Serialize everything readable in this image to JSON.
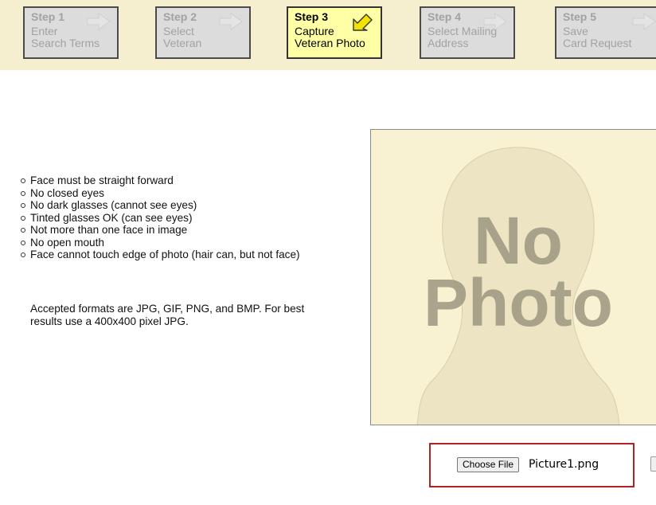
{
  "wizard": {
    "steps": [
      {
        "num": "Step 1",
        "line1": "Enter",
        "line2": "Search Terms",
        "state": "inactive",
        "icon": "arrow-right-icon"
      },
      {
        "num": "Step 2",
        "line1": "Select",
        "line2": "Veteran",
        "state": "inactive",
        "icon": "arrow-right-icon"
      },
      {
        "num": "Step 3",
        "line1": "Capture",
        "line2": "Veteran Photo",
        "state": "active",
        "icon": "arrow-down-left-icon"
      },
      {
        "num": "Step 4",
        "line1": "Select Mailing",
        "line2": "Address",
        "state": "inactive",
        "icon": "arrow-right-icon"
      },
      {
        "num": "Step 5",
        "line1": "Save",
        "line2": "Card Request",
        "state": "inactive",
        "icon": "arrow-right-icon"
      }
    ]
  },
  "guidelines": {
    "rules": [
      "Face must be straight forward",
      "No closed eyes",
      "No dark glasses (cannot see eyes)",
      "Tinted glasses OK (can see eyes)",
      "Not more than one face in image",
      "No open mouth",
      "Face cannot touch edge of photo (hair can, but not face)"
    ],
    "formats": "Accepted formats are JPG, GIF, PNG, and BMP. For best results use a 400x400 pixel JPG."
  },
  "photo": {
    "placeholder_line1": "No",
    "placeholder_line2": "Photo"
  },
  "upload": {
    "choose_label": "Choose File",
    "file_name": "Picture1.png"
  },
  "colors": {
    "stepbar_bg": "#f5efcf",
    "active_step_bg": "#ffffa6",
    "inactive_step_bg": "#dcdcdc",
    "highlight_border": "#b22222"
  }
}
